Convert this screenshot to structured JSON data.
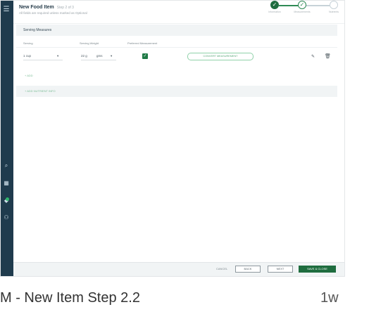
{
  "header": {
    "title": "New Food Item",
    "step": "Step 2 of 3",
    "subtitle": "All fields are required unless marked as Optional"
  },
  "stepper": {
    "steps": [
      "Information",
      "Measurements",
      "Nutrients"
    ]
  },
  "serving_section": {
    "title": "Serving Measures",
    "columns": [
      "Serving",
      "Serving Weight",
      "Preferred Measurement"
    ],
    "row": {
      "serving_qty": "1 cup",
      "weight": "22 g",
      "unit": "gms",
      "preferred": true,
      "button_label": "CONVERT MEASUREMENT"
    }
  },
  "add_link": "+ ADD",
  "nutrient_link": "+ ADD NUTRIENT INFO",
  "footer": {
    "cancel": "CANCEL",
    "back": "BACK",
    "next": "NEXT",
    "save": "SAVE & CLOSE"
  },
  "caption": {
    "title": "M - New Item Step 2.2",
    "time": "1w"
  },
  "colors": {
    "rail": "#1f3b4d",
    "accent": "#1f6d3f",
    "accent_light": "#8fd1a9"
  }
}
